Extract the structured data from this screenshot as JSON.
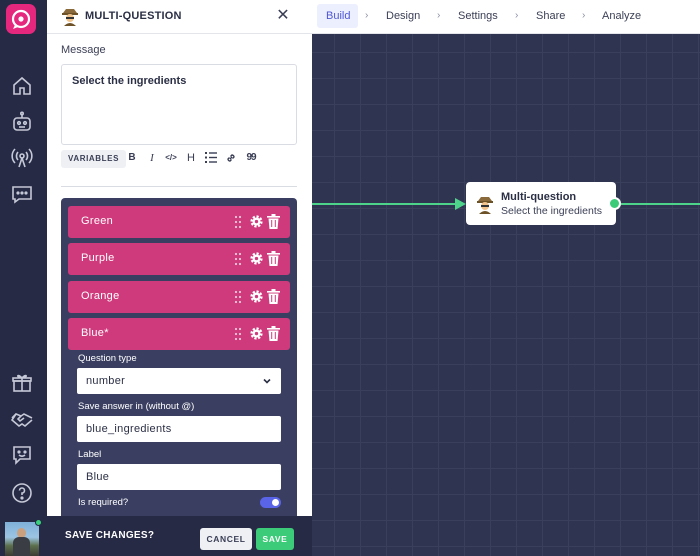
{
  "panel": {
    "title": "MULTI-QUESTION",
    "message_label": "Message",
    "message_text": "Select the ingredients",
    "toolbar": {
      "variables": "VARIABLES",
      "bold": "B",
      "italic": "I",
      "code": "</>",
      "heading": "H",
      "quote": "99"
    },
    "items": [
      {
        "label": "Green"
      },
      {
        "label": "Purple"
      },
      {
        "label": "Orange"
      },
      {
        "label": "Blue*"
      }
    ],
    "expanded": {
      "question_type_label": "Question type",
      "question_type_value": "number",
      "save_answer_label": "Save answer in (without @)",
      "save_answer_value": "blue_ingredients",
      "label_label": "Label",
      "label_value": "Blue",
      "is_required_label": "Is required?",
      "is_required": true
    },
    "save_bar": {
      "text": "SAVE CHANGES?",
      "cancel": "CANCEL",
      "save": "SAVE"
    }
  },
  "nav": {
    "items": [
      "Build",
      "Design",
      "Settings",
      "Share",
      "Analyze"
    ],
    "active": "Build",
    "separator": "›"
  },
  "node": {
    "title": "Multi-question",
    "subtitle": "Select the ingredients"
  },
  "colors": {
    "accent": "#4f57d6",
    "item_bg": "#cf3a7c",
    "edge": "#4ed38b",
    "save": "#3ccb79",
    "logo": "#e5277e"
  }
}
